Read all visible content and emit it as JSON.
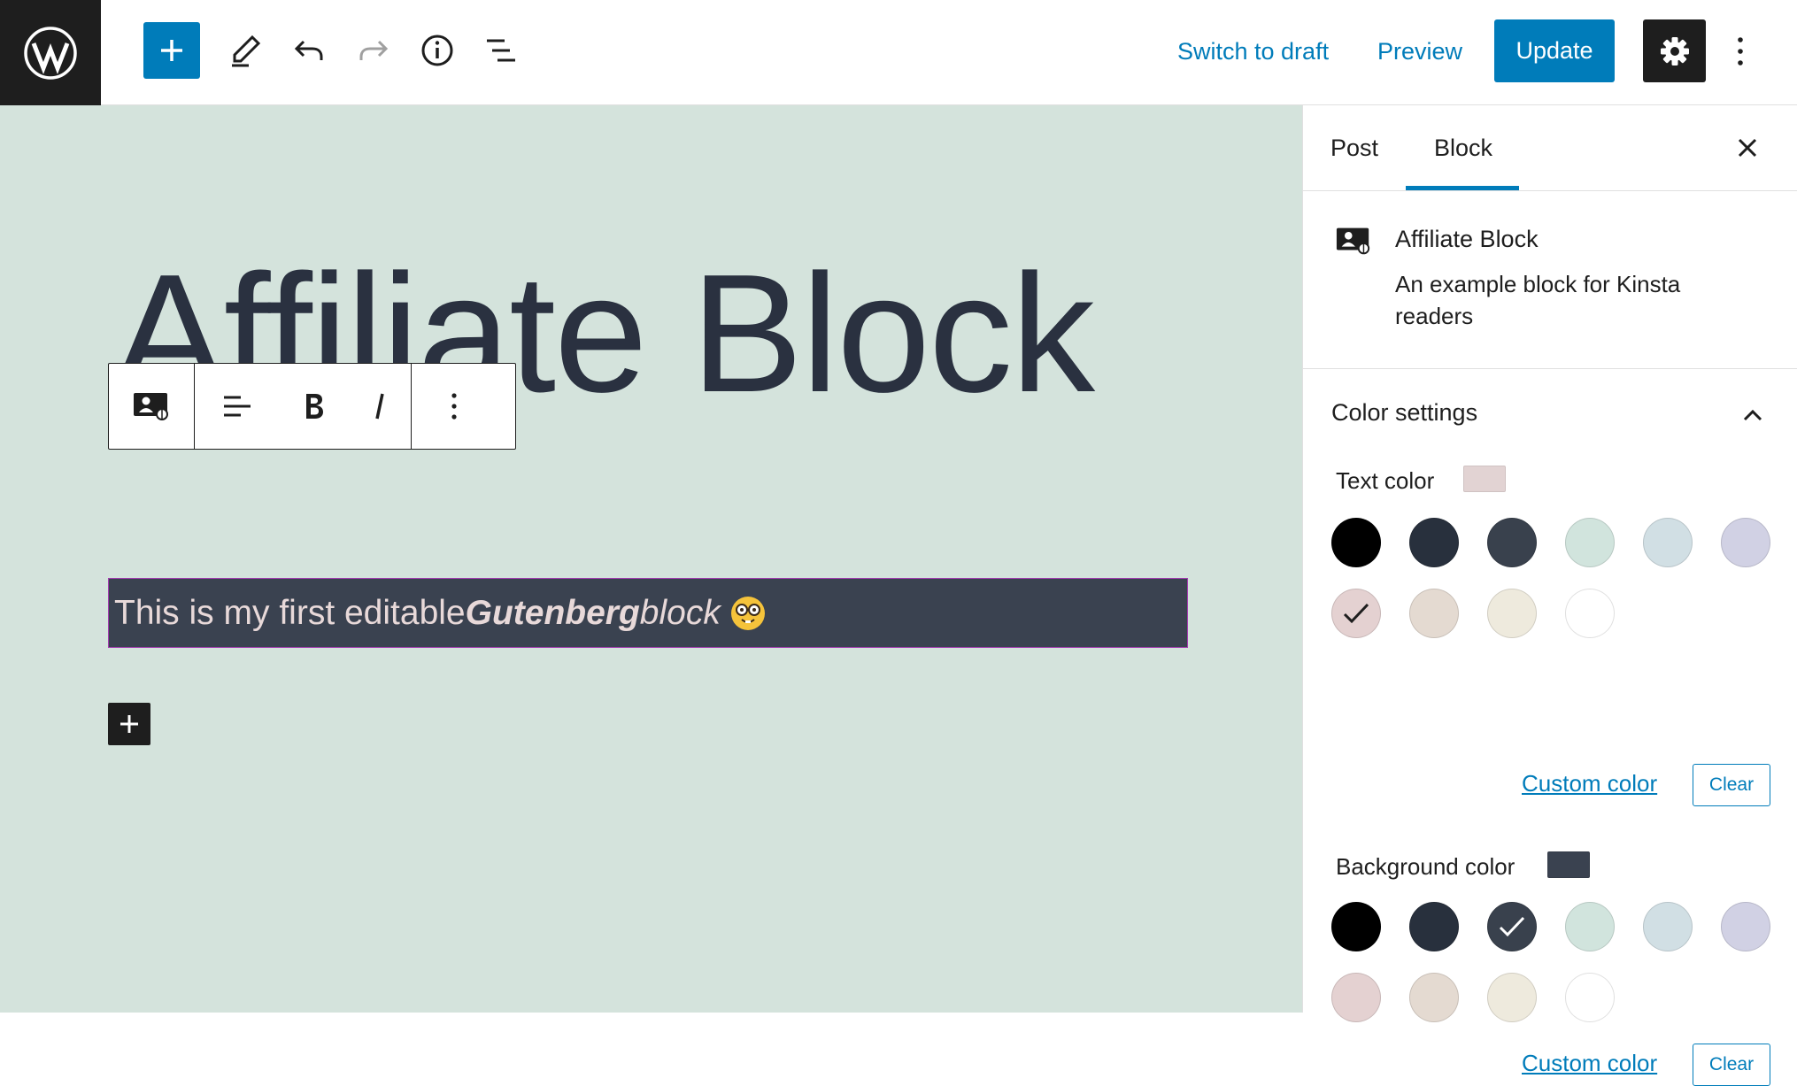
{
  "header": {
    "switch_to_draft_label": "Switch to draft",
    "preview_label": "Preview",
    "update_label": "Update"
  },
  "editor": {
    "title": "Affiliate Block",
    "block_text_plain": "This is my first editable ",
    "block_text_bold_italic": "Gutenberg",
    "block_text_italic": " block"
  },
  "sidebar": {
    "tabs": [
      {
        "label": "Post",
        "active": false
      },
      {
        "label": "Block",
        "active": true
      }
    ],
    "block_card": {
      "name": "Affiliate Block",
      "description": "An example block for Kinsta readers"
    },
    "color_panel": {
      "title": "Color settings",
      "expanded": true,
      "text_color": {
        "label": "Text color",
        "selected": "#e2d3d3",
        "custom_label": "Custom color",
        "clear_label": "Clear"
      },
      "background_color": {
        "label": "Background color",
        "selected": "#3a4250",
        "custom_label": "Custom color",
        "clear_label": "Clear"
      },
      "palette": [
        "#000000",
        "#28303d",
        "#39414d",
        "#d1e4dd",
        "#d1dfe4",
        "#d1d1e4",
        "#e4d1d1",
        "#e4dad1",
        "#eeeadd",
        "#ffffff"
      ]
    }
  },
  "colors": {
    "accent": "#007cba",
    "canvas_background": "#d4e3dc",
    "title_color": "#2a3140",
    "block_background": "#3a4250",
    "block_text": "#e8d9d9"
  },
  "icons": {
    "logo": "wordpress-logo",
    "add": "plus-icon",
    "tools": "pencil-icon",
    "undo": "undo-icon",
    "redo": "redo-icon",
    "details": "info-icon",
    "outline": "list-view-icon",
    "settings": "gear-icon",
    "options": "more-vertical-icon",
    "close": "close-icon",
    "block": "affiliate-block-icon",
    "align": "align-left-icon",
    "bold": "bold-icon",
    "italic": "italic-icon",
    "panel_toggle": "chevron-up-icon",
    "selected": "checkmark-icon",
    "inserter": "plus-icon"
  }
}
